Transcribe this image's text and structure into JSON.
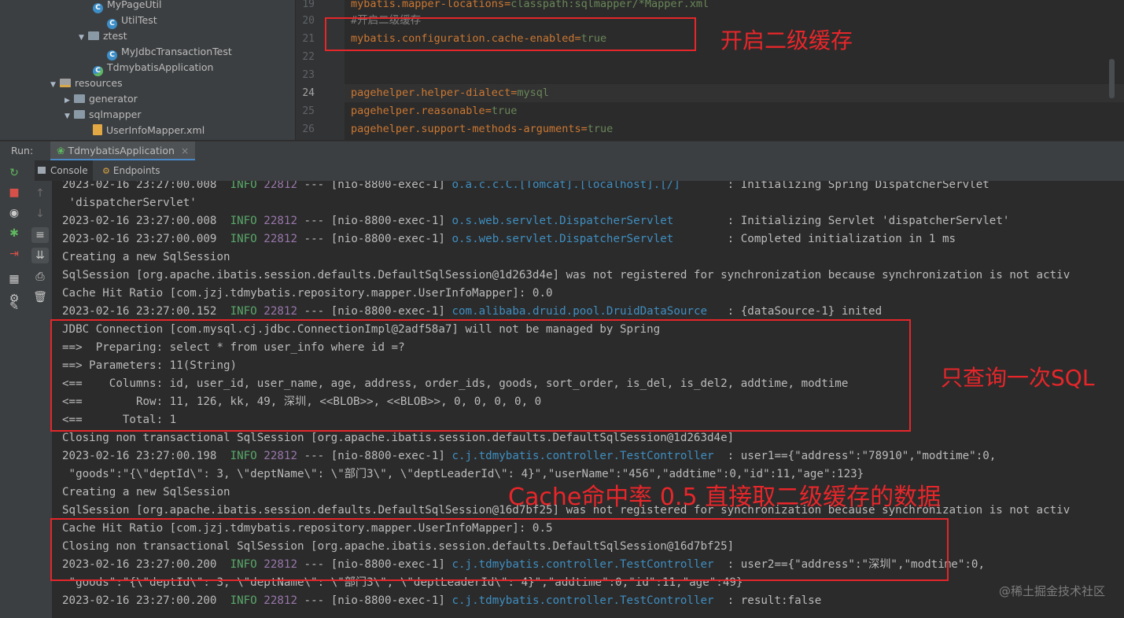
{
  "project_tree": [
    {
      "label": "MyPageUtil",
      "kind": "class"
    },
    {
      "label": "UtilTest",
      "kind": "class"
    },
    {
      "label": "ztest",
      "kind": "package"
    },
    {
      "label": "MyJdbcTransactionTest",
      "kind": "class"
    },
    {
      "label": "TdmybatisApplication",
      "kind": "app"
    },
    {
      "label": "resources",
      "kind": "resfolder"
    },
    {
      "label": "generator",
      "kind": "folder"
    },
    {
      "label": "sqlmapper",
      "kind": "folder"
    },
    {
      "label": "UserInfoMapper.xml",
      "kind": "xml"
    }
  ],
  "editor": {
    "lines": [
      {
        "no": "19",
        "key": "mybatis.mapper-locations",
        "value": "classpath:sqlmapper/*Mapper.xml"
      },
      {
        "no": "20",
        "comment": "#开启二级缓存"
      },
      {
        "no": "21",
        "key": "mybatis.configuration.cache-enabled",
        "value": "true"
      },
      {
        "no": "22"
      },
      {
        "no": "23"
      },
      {
        "no": "24",
        "key": "pagehelper.helper-dialect",
        "value": "mysql"
      },
      {
        "no": "25",
        "key": "pagehelper.reasonable",
        "value": "true"
      },
      {
        "no": "26",
        "key": "pagehelper.support-methods-arguments",
        "value": "true"
      }
    ]
  },
  "run": {
    "label": "Run:",
    "tab": "TdmybatisApplication",
    "subtabs": [
      "Console",
      "Endpoints"
    ]
  },
  "console": {
    "lines": [
      {
        "t": "log",
        "ts": "2023-02-16 23:27:00.008",
        "level": "INFO",
        "pid": "22812",
        "thread": "--- [nio-8800-exec-1]",
        "logger": "o.a.c.c.C.[Tomcat].[localhost].[/]      ",
        "msg": " : Initializing Spring DispatcherServlet"
      },
      {
        "t": "plain",
        "text": " 'dispatcherServlet'"
      },
      {
        "t": "log",
        "ts": "2023-02-16 23:27:00.008",
        "level": "INFO",
        "pid": "22812",
        "thread": "--- [nio-8800-exec-1]",
        "logger": "o.s.web.servlet.DispatcherServlet       ",
        "msg": " : Initializing Servlet 'dispatcherServlet'"
      },
      {
        "t": "log",
        "ts": "2023-02-16 23:27:00.009",
        "level": "INFO",
        "pid": "22812",
        "thread": "--- [nio-8800-exec-1]",
        "logger": "o.s.web.servlet.DispatcherServlet       ",
        "msg": " : Completed initialization in 1 ms"
      },
      {
        "t": "plain",
        "text": "Creating a new SqlSession"
      },
      {
        "t": "plain",
        "text": "SqlSession [org.apache.ibatis.session.defaults.DefaultSqlSession@1d263d4e] was not registered for synchronization because synchronization is not activ"
      },
      {
        "t": "plain",
        "text": "Cache Hit Ratio [com.jzj.tdmybatis.repository.mapper.UserInfoMapper]: 0.0"
      },
      {
        "t": "log",
        "ts": "2023-02-16 23:27:00.152",
        "level": "INFO",
        "pid": "22812",
        "thread": "--- [nio-8800-exec-1]",
        "logger": "com.alibaba.druid.pool.DruidDataSource  ",
        "msg": " : {dataSource-1} inited"
      },
      {
        "t": "plain",
        "text": "JDBC Connection [com.mysql.cj.jdbc.ConnectionImpl@2adf58a7] will not be managed by Spring"
      },
      {
        "t": "plain",
        "text": "==>  Preparing: select * from user_info where id =?"
      },
      {
        "t": "plain",
        "text": "==> Parameters: 11(String)"
      },
      {
        "t": "plain",
        "text": "<==    Columns: id, user_id, user_name, age, address, order_ids, goods, sort_order, is_del, is_del2, addtime, modtime"
      },
      {
        "t": "plain",
        "text": "<==        Row: 11, 126, kk, 49, 深圳, <<BLOB>>, <<BLOB>>, 0, 0, 0, 0, 0"
      },
      {
        "t": "plain",
        "text": "<==      Total: 1"
      },
      {
        "t": "plain",
        "text": "Closing non transactional SqlSession [org.apache.ibatis.session.defaults.DefaultSqlSession@1d263d4e]"
      },
      {
        "t": "log",
        "ts": "2023-02-16 23:27:00.198",
        "level": "INFO",
        "pid": "22812",
        "thread": "--- [nio-8800-exec-1]",
        "logger": "c.j.tdmybatis.controller.TestController ",
        "msg": " : user1=={\"address\":\"78910\",\"modtime\":0,"
      },
      {
        "t": "plain",
        "text": " \"goods\":\"{\\\"deptId\\\": 3, \\\"deptName\\\": \\\"部门3\\\", \\\"deptLeaderId\\\": 4}\",\"userName\":\"456\",\"addtime\":0,\"id\":11,\"age\":123}"
      },
      {
        "t": "plain",
        "text": "Creating a new SqlSession"
      },
      {
        "t": "plain",
        "text": "SqlSession [org.apache.ibatis.session.defaults.DefaultSqlSession@16d7bf25] was not registered for synchronization because synchronization is not activ"
      },
      {
        "t": "plain",
        "text": "Cache Hit Ratio [com.jzj.tdmybatis.repository.mapper.UserInfoMapper]: 0.5"
      },
      {
        "t": "plain",
        "text": "Closing non transactional SqlSession [org.apache.ibatis.session.defaults.DefaultSqlSession@16d7bf25]"
      },
      {
        "t": "log",
        "ts": "2023-02-16 23:27:00.200",
        "level": "INFO",
        "pid": "22812",
        "thread": "--- [nio-8800-exec-1]",
        "logger": "c.j.tdmybatis.controller.TestController ",
        "msg": " : user2=={\"address\":\"深圳\",\"modtime\":0,"
      },
      {
        "t": "plain",
        "text": " \"goods\":\"{\\\"deptId\\\": 3, \\\"deptName\\\": \\\"部门3\\\", \\\"deptLeaderId\\\": 4}\",\"addtime\":0,\"id\":11,\"age\":49}"
      },
      {
        "t": "log",
        "ts": "2023-02-16 23:27:00.200",
        "level": "INFO",
        "pid": "22812",
        "thread": "--- [nio-8800-exec-1]",
        "logger": "c.j.tdmybatis.controller.TestController ",
        "msg": " : result:false"
      }
    ]
  },
  "annotations": {
    "note1": "开启二级缓存",
    "note2": "只查询一次SQL",
    "note3": "Cache命中率 0.5  直接取二级缓存的数据",
    "accent": "#e5262a"
  },
  "watermark": "@稀土掘金技术社区"
}
